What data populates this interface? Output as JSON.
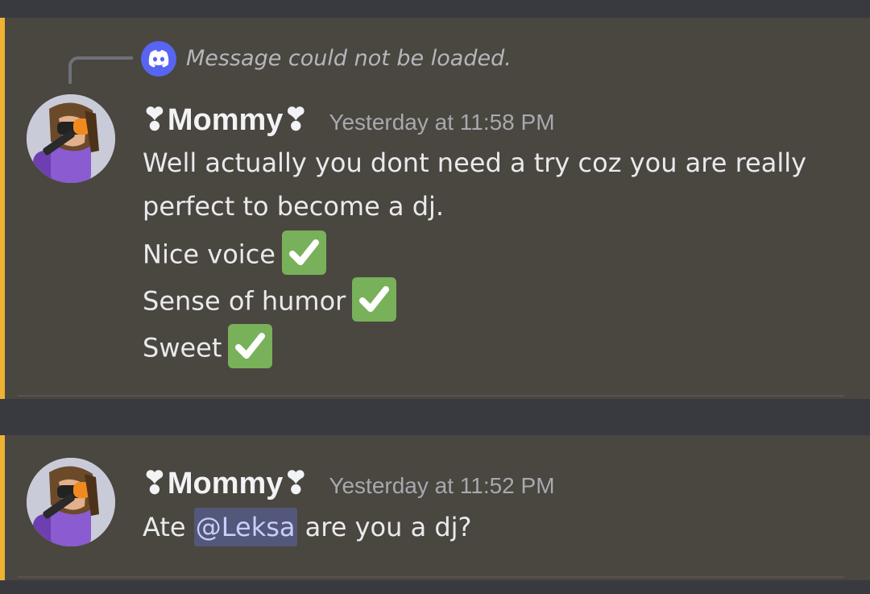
{
  "reply": {
    "text": "Message could not be loaded.",
    "icon": "discord-logo-icon"
  },
  "messages": [
    {
      "username": "❣Mommy❣",
      "timestamp": "Yesterday at 11:58 PM",
      "lines": [
        "Well actually you dont need a try coz you are really",
        "perfect to become a dj.",
        "Nice voice",
        "Sense of humor",
        "Sweet"
      ],
      "check_icon": "white-heavy-check-mark-icon"
    },
    {
      "username": "❣Mommy❣",
      "timestamp": "Yesterday at 11:52 PM",
      "text_before": "Ate",
      "mention": "@Leksa",
      "text_after": "are you a dj?"
    }
  ],
  "colors": {
    "accent_bar": "#f0b232",
    "message_bg": "#4a4640",
    "mention_bg": "#535779",
    "mention_text": "#c9cdfb",
    "check_bg": "#78b159",
    "discord_blurple": "#5865f2"
  }
}
